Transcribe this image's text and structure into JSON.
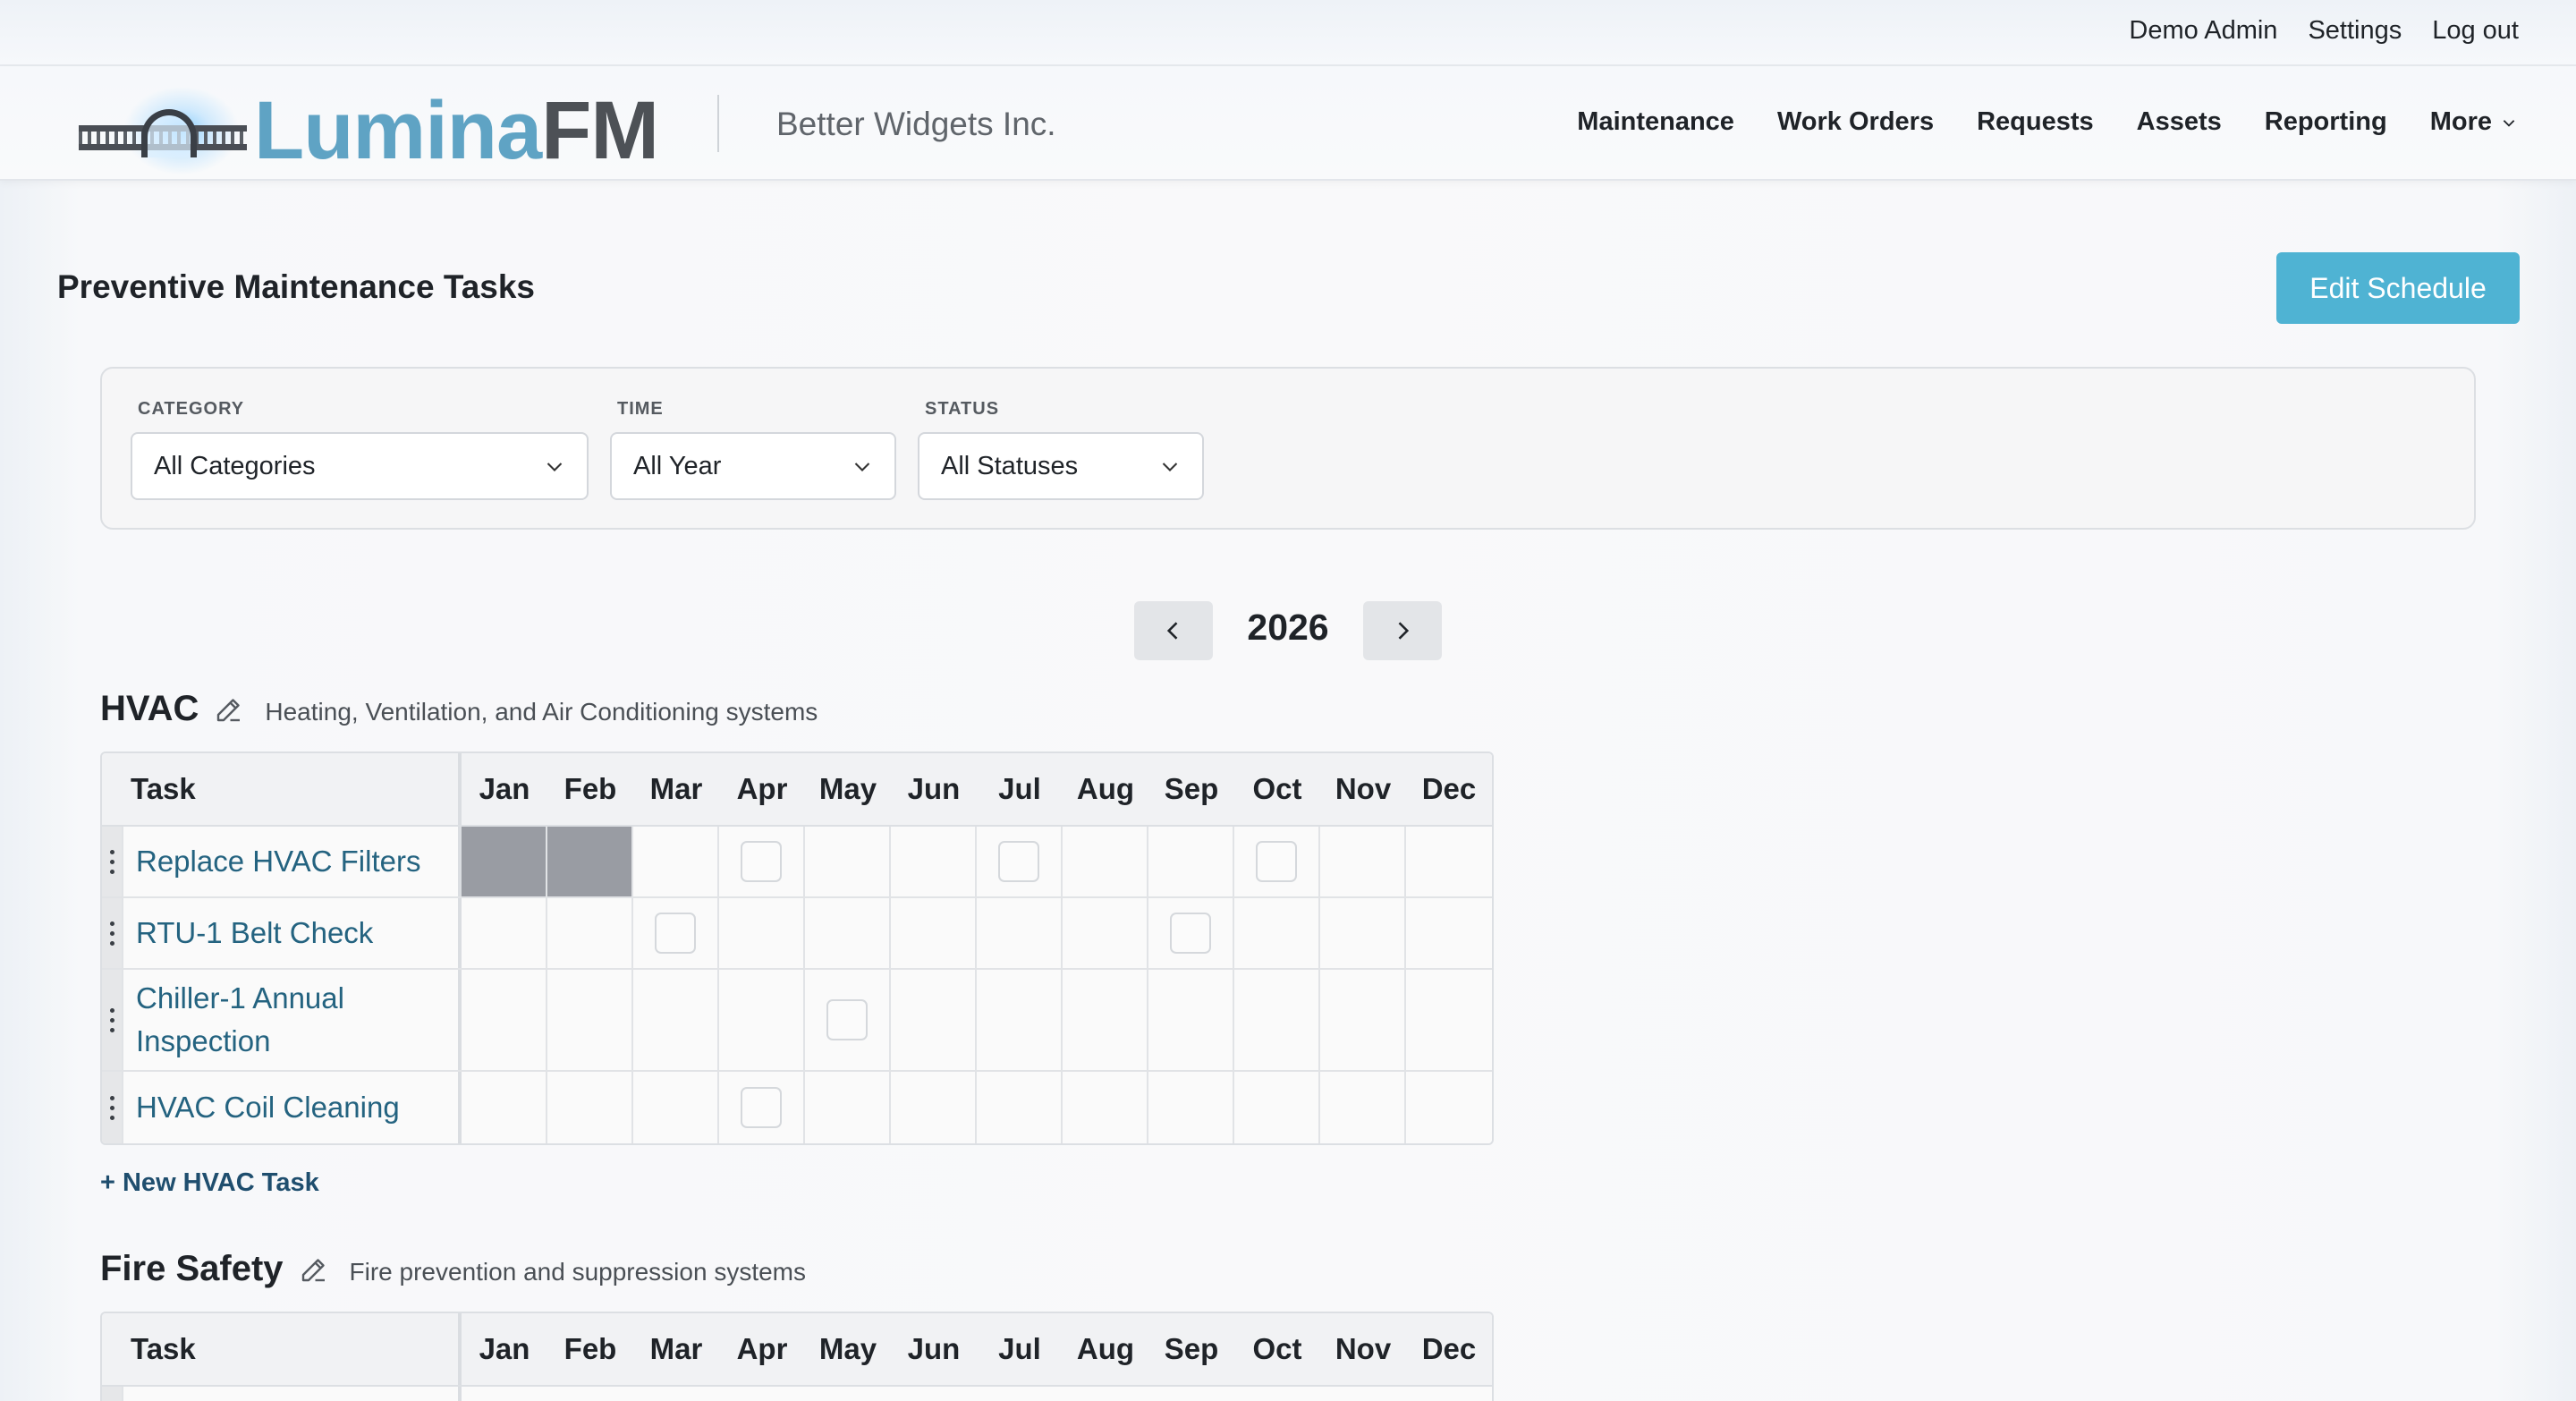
{
  "topbar": {
    "user": "Demo Admin",
    "settings": "Settings",
    "logout": "Log out"
  },
  "header": {
    "logo_part1": "Lumina",
    "logo_part2": "FM",
    "company": "Better Widgets Inc.",
    "nav": [
      "Maintenance",
      "Work Orders",
      "Requests",
      "Assets",
      "Reporting",
      "More"
    ]
  },
  "page": {
    "title": "Preventive Maintenance Tasks",
    "edit_button": "Edit Schedule"
  },
  "filters": {
    "category": {
      "label": "CATEGORY",
      "value": "All Categories"
    },
    "time": {
      "label": "TIME",
      "value": "All Year"
    },
    "status": {
      "label": "STATUS",
      "value": "All Statuses"
    }
  },
  "year": "2026",
  "months": [
    "Jan",
    "Feb",
    "Mar",
    "Apr",
    "May",
    "Jun",
    "Jul",
    "Aug",
    "Sep",
    "Oct",
    "Nov",
    "Dec"
  ],
  "task_header": "Task",
  "sections": [
    {
      "name": "HVAC",
      "description": "Heating, Ventilation, and Air Conditioning systems",
      "new_task": "+ New HVAC Task",
      "tasks": [
        {
          "name": "Replace HVAC Filters",
          "filled": [
            0,
            1
          ],
          "scheduled": [
            3,
            6,
            9
          ]
        },
        {
          "name": "RTU-1 Belt Check",
          "filled": [],
          "scheduled": [
            2,
            8
          ]
        },
        {
          "name": "Chiller-1 Annual Inspection",
          "filled": [],
          "scheduled": [
            4
          ]
        },
        {
          "name": "HVAC Coil Cleaning",
          "filled": [],
          "scheduled": [
            3
          ]
        }
      ]
    },
    {
      "name": "Fire Safety",
      "description": "Fire prevention and suppression systems",
      "tasks": []
    }
  ]
}
